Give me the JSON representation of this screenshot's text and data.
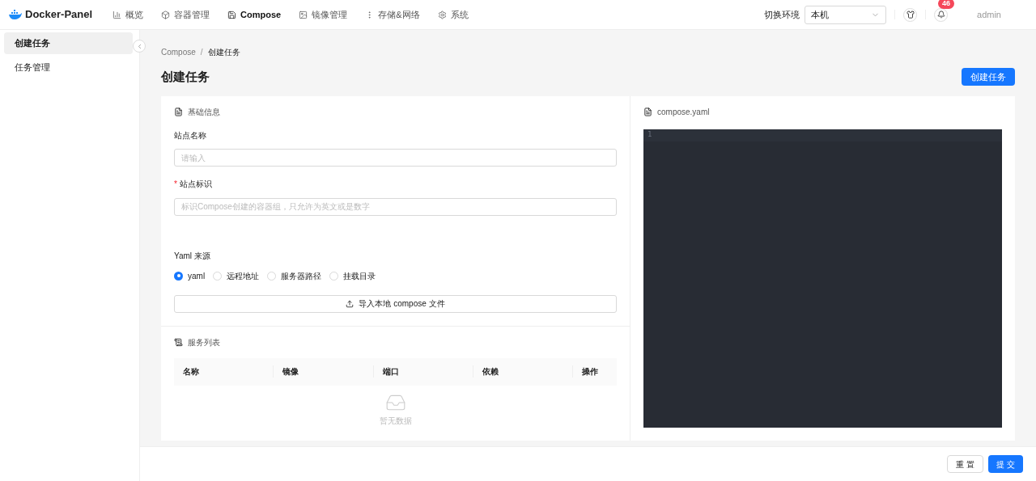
{
  "header": {
    "logo": "Docker-Panel",
    "nav": [
      {
        "label": "概览",
        "selected": false
      },
      {
        "label": "容器管理",
        "selected": false
      },
      {
        "label": "Compose",
        "selected": true
      },
      {
        "label": "镜像管理",
        "selected": false
      },
      {
        "label": "存储&网络",
        "selected": false
      },
      {
        "label": "系统",
        "selected": false
      }
    ],
    "env_label": "切换环境",
    "env_value": "本机",
    "notification_count": "46",
    "user": "admin"
  },
  "sidebar": {
    "items": [
      {
        "label": "创建任务",
        "selected": true
      },
      {
        "label": "任务管理",
        "selected": false
      }
    ]
  },
  "breadcrumb": [
    "Compose",
    "创建任务"
  ],
  "breadcrumb_separator": "/",
  "required_mark": "*",
  "page_title": "创建任务",
  "create_button": "创建任务",
  "basic": {
    "title": "基础信息",
    "fields": [
      {
        "label": "站点名称",
        "required": false,
        "placeholder": "请输入"
      },
      {
        "label": "站点标识",
        "required": true,
        "placeholder": "标识Compose创建的容器组，只允许为英文或是数字"
      }
    ],
    "source_label": "Yaml 来源",
    "sources": [
      {
        "label": "yaml",
        "selected": true
      },
      {
        "label": "远程地址",
        "selected": false
      },
      {
        "label": "服务器路径",
        "selected": false
      },
      {
        "label": "挂载目录",
        "selected": false
      }
    ],
    "import_button": "导入本地 compose 文件"
  },
  "services": {
    "title": "服务列表",
    "columns": [
      "名称",
      "镜像",
      "端口",
      "依赖",
      "操作"
    ],
    "empty": "暂无数据"
  },
  "editor": {
    "title": "compose.yaml",
    "line_numbers": [
      "1"
    ]
  },
  "footer": {
    "reset": "重 置",
    "submit": "提 交"
  }
}
